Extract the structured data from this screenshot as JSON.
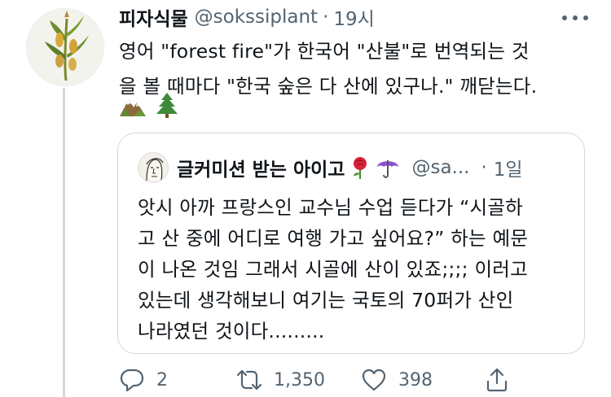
{
  "tweet": {
    "display_name": "피자식물",
    "handle": "@sokssiplant",
    "separator": "·",
    "time": "19시",
    "text_line1": "영어 \"forest fire\"가 한국어 \"산불\"로 번역되는 것",
    "text_line2": "을 볼 때마다 \"한국 숲은 다 산에 있구나.\" 깨닫는다.",
    "emojis": [
      "mountain-emoji",
      "evergreen-tree-emoji"
    ]
  },
  "quote": {
    "display_name": "글커미션 받는 아이고",
    "emojis": [
      "rose-emoji",
      "umbrella-emoji"
    ],
    "handle": "@sa...",
    "separator": "·",
    "time": "1일",
    "lines": [
      "앗시 아까 프랑스인 교수님 수업 듣다가 “시골하",
      "고 산 중에 어디로 여행 가고 싶어요?” 하는 예문",
      "이 나온 것임 그래서 시골에 산이 있죠;;;; 이러고",
      "있는데 생각해보니 여기는 국토의 70퍼가 산인",
      "나라였던 것이다........."
    ]
  },
  "actions": {
    "reply_count": "2",
    "retweet_count": "1,350",
    "like_count": "398"
  },
  "icons": {
    "reply": "reply-icon",
    "retweet": "retweet-icon",
    "like": "like-icon",
    "share": "share-icon",
    "more": "more-icon"
  },
  "colors": {
    "text": "#0f1419",
    "secondary": "#536471",
    "border": "#cfd9de"
  }
}
